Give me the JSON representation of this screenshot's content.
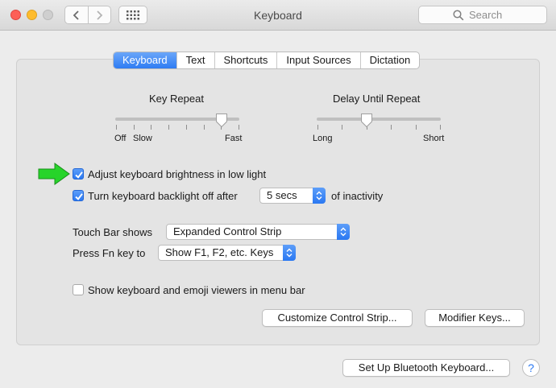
{
  "window": {
    "title": "Keyboard"
  },
  "search": {
    "placeholder": "Search"
  },
  "tabs": [
    {
      "label": "Keyboard",
      "active": true
    },
    {
      "label": "Text",
      "active": false
    },
    {
      "label": "Shortcuts",
      "active": false
    },
    {
      "label": "Input Sources",
      "active": false
    },
    {
      "label": "Dictation",
      "active": false
    }
  ],
  "key_repeat": {
    "title": "Key Repeat",
    "labels": [
      "Off",
      "Slow",
      "Fast"
    ],
    "value": 0.86
  },
  "delay_until_repeat": {
    "title": "Delay Until Repeat",
    "labels": [
      "Long",
      "Short"
    ],
    "value": 0.4
  },
  "options": {
    "brightness": {
      "label": "Adjust keyboard brightness in low light",
      "checked": true
    },
    "backlight": {
      "label": "Turn keyboard backlight off after",
      "checked": true,
      "value": "5 secs",
      "suffix": "of inactivity"
    },
    "emoji_viewer": {
      "label": "Show keyboard and emoji viewers in menu bar",
      "checked": false
    }
  },
  "touch_bar": {
    "label": "Touch Bar shows",
    "value": "Expanded Control Strip"
  },
  "fn_key": {
    "label": "Press Fn key to",
    "value": "Show F1, F2, etc. Keys"
  },
  "buttons": {
    "customize": "Customize Control Strip...",
    "modifier": "Modifier Keys...",
    "bluetooth": "Set Up Bluetooth Keyboard...",
    "help": "?"
  },
  "colors": {
    "accent": "#2e7cf3",
    "annotation_arrow": "#27d42a"
  }
}
